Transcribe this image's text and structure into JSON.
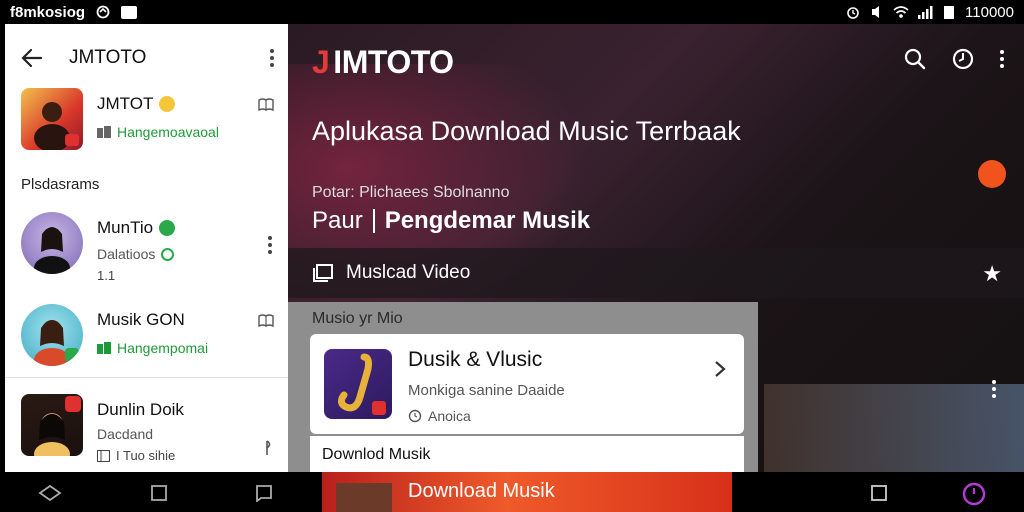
{
  "status_bar": {
    "left_text": "f8mkosiog",
    "time": "110000"
  },
  "left_panel": {
    "title": "JMTOTO",
    "now_playing": {
      "title": "JMTOT",
      "subtitle": "Hangemoavaoal"
    },
    "section_label": "Plsdasrams",
    "items": [
      {
        "title": "MunTio",
        "subtitle": "Dalatioos",
        "extra": "1.1"
      },
      {
        "title": "Musik GON",
        "subtitle": "Hangempomai"
      },
      {
        "title": "Dunlin Doik",
        "subtitle": "Dacdand",
        "extra": "I Tuo sihie"
      }
    ]
  },
  "main": {
    "logo_text": "IMTOTO",
    "heading": "Aplukasa Download Music Terrbaak",
    "sub_small": "Potar: Plichaees Sbolnanno",
    "sub_big_prefix": "Paur",
    "sub_big_strong": "Pengdemar Musik",
    "video_row_label": "Muslcad Video",
    "panel_label": "Musio yr Mio",
    "card": {
      "title": "Dusik & Vlusic",
      "subtitle": "Monkiga sanine Daaide",
      "meta": "Anoica"
    },
    "card2_title": "Downlod Musik",
    "banner_text": "Download Musik"
  },
  "colors": {
    "accent_orange": "#f0531c",
    "green": "#1f9a3b",
    "purple": "#b43bd8"
  }
}
